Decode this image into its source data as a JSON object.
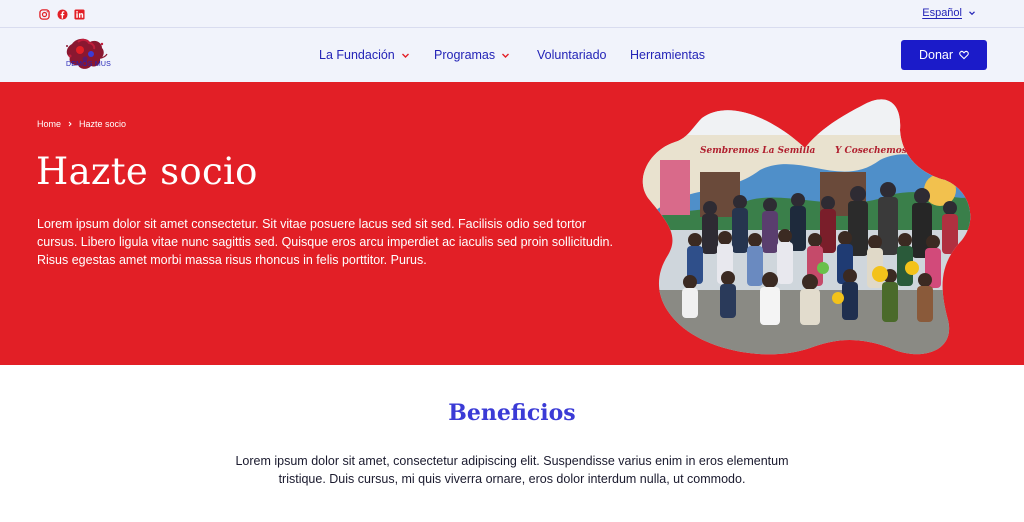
{
  "topbar": {
    "social_icons": [
      "instagram-icon",
      "facebook-icon",
      "linkedin-icon"
    ],
    "language": "Español"
  },
  "navbar": {
    "logo_text": "DEMOS MUS",
    "items": [
      {
        "label": "La Fundación",
        "has_dropdown": true
      },
      {
        "label": "Programas",
        "has_dropdown": true
      },
      {
        "label": "Voluntariado",
        "has_dropdown": false
      },
      {
        "label": "Herramientas",
        "has_dropdown": false
      }
    ],
    "donate_label": "Donar"
  },
  "hero": {
    "breadcrumb": [
      "Home",
      "Hazte socio"
    ],
    "title": "Hazte socio",
    "description": "Lorem ipsum dolor sit amet consectetur. Sit vitae posuere lacus sed sit sed. Facilisis odio sed tortor cursus. Libero ligula vitae nunc sagittis sed. Quisque eros arcu imperdiet ac iaculis sed proin sollicitudin. Risus egestas amet morbi massa risus rhoncus in felis porttitor. Purus.",
    "mural_text_left": "Sembremos La Semilla",
    "mural_text_right": "Y Cosechemos La Esperanza"
  },
  "benefits": {
    "title": "Beneficios",
    "text": "Lorem ipsum dolor sit amet, consectetur adipiscing elit. Suspendisse varius enim in eros elementum tristique. Duis cursus, mi quis viverra ornare, eros dolor interdum nulla, ut commodo."
  },
  "colors": {
    "brand_blue": "#1b1bc9",
    "nav_text": "#2323b7",
    "hero_red": "#e21f26",
    "heading_blue": "#3b3bd6",
    "topbar_bg": "#f1f3fb"
  }
}
